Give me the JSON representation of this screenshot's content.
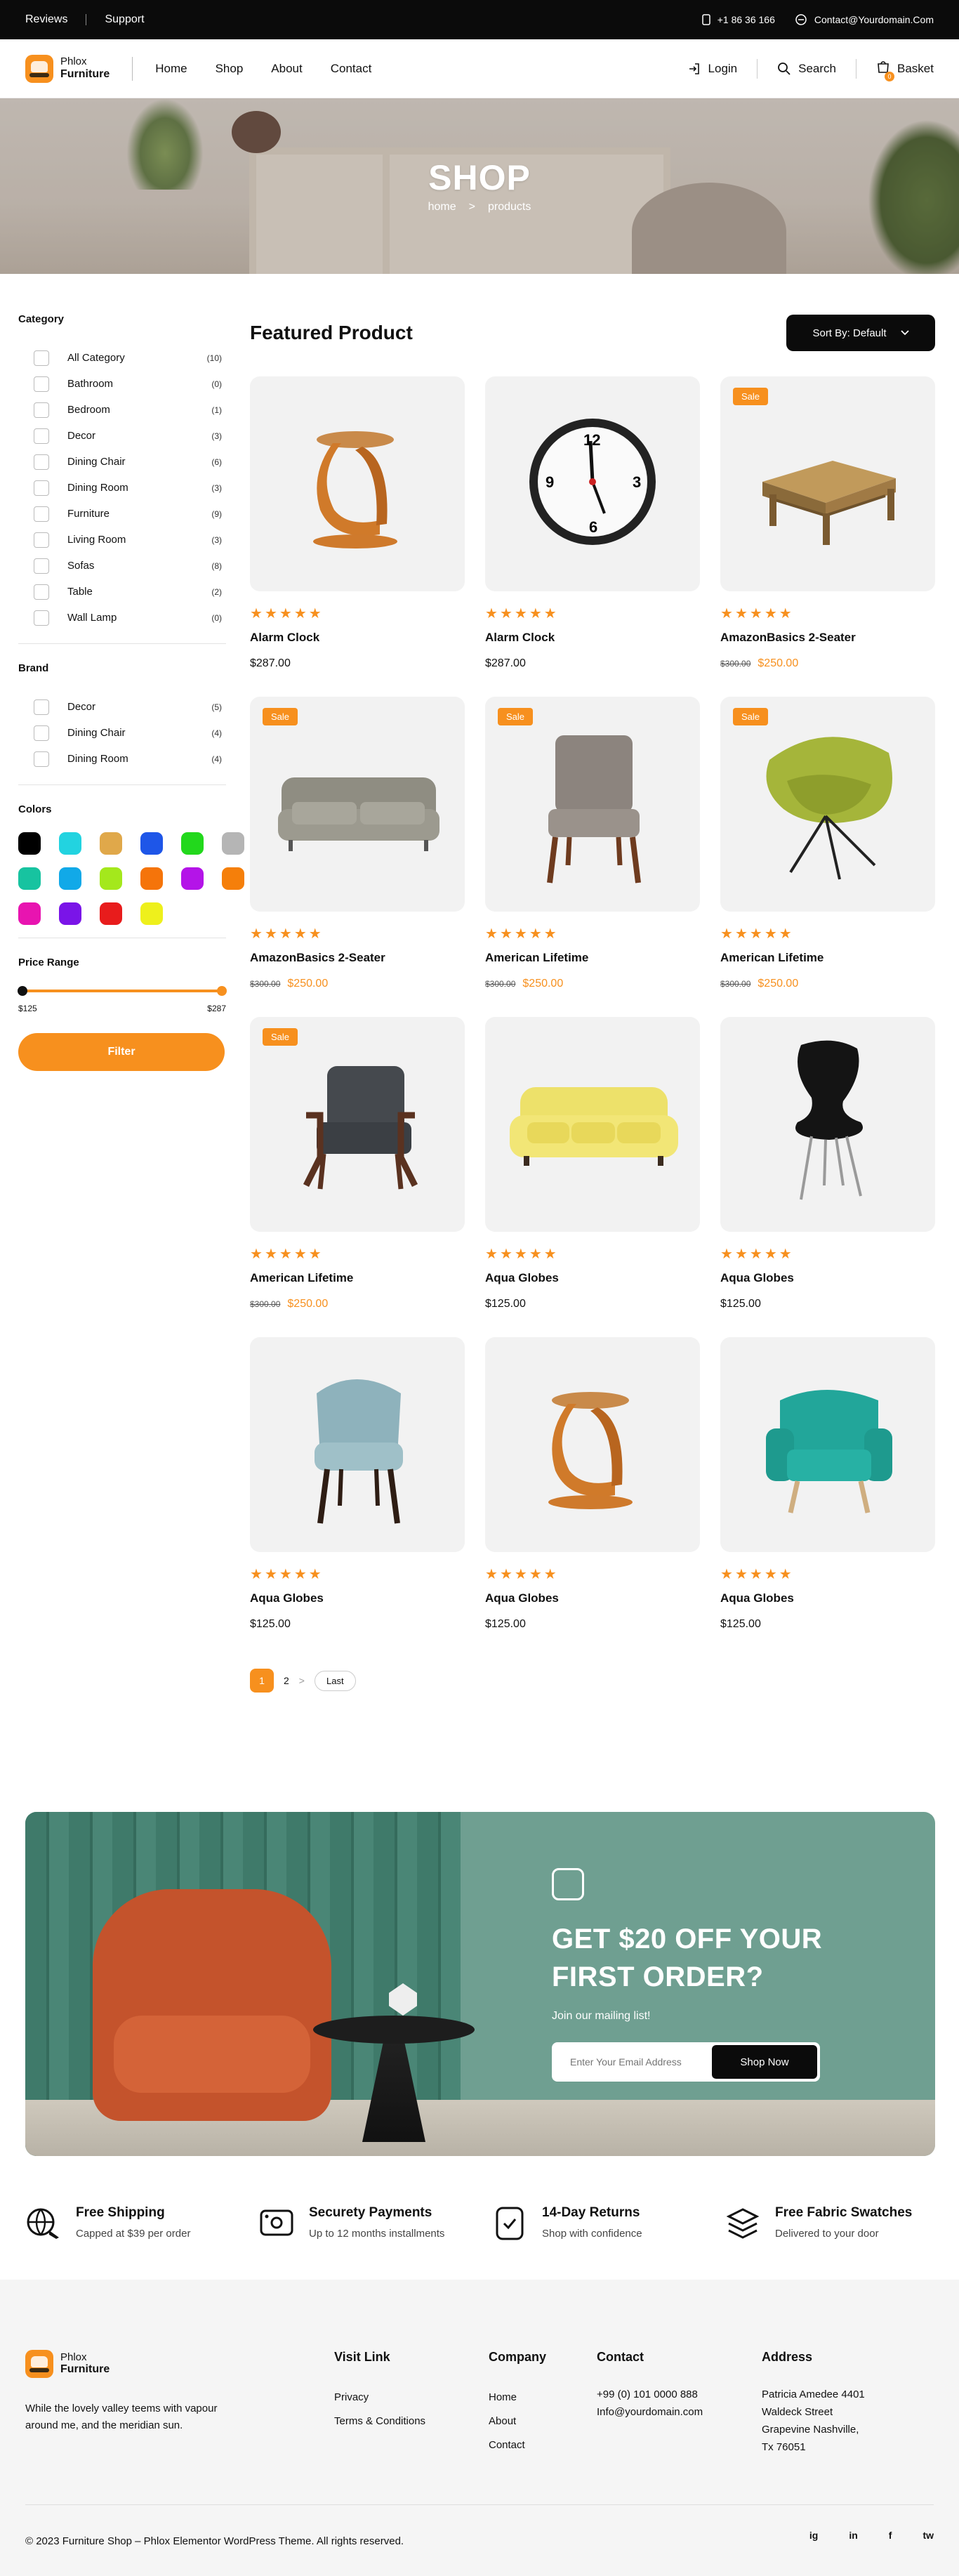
{
  "topbar": {
    "reviews": "Reviews",
    "support": "Support",
    "phone": "+1 86 36 166",
    "email": "Contact@Yourdomain.Com"
  },
  "header": {
    "logo_line1": "Phlox",
    "logo_line2": "Furniture",
    "nav": [
      "Home",
      "Shop",
      "About",
      "Contact"
    ],
    "login": "Login",
    "search": "Search",
    "basket": "Basket",
    "basket_count": "0"
  },
  "hero": {
    "title": "SHOP",
    "crumb_home": "home",
    "crumb_sep": ">",
    "crumb_current": "products"
  },
  "sidebar": {
    "category_title": "Category",
    "categories": [
      {
        "label": "All Category",
        "count": "(10)"
      },
      {
        "label": "Bathroom",
        "count": "(0)"
      },
      {
        "label": "Bedroom",
        "count": "(1)"
      },
      {
        "label": "Decor",
        "count": "(3)"
      },
      {
        "label": "Dining Chair",
        "count": "(6)"
      },
      {
        "label": "Dining Room",
        "count": "(3)"
      },
      {
        "label": "Furniture",
        "count": "(9)"
      },
      {
        "label": "Living Room",
        "count": "(3)"
      },
      {
        "label": "Sofas",
        "count": "(8)"
      },
      {
        "label": "Table",
        "count": "(2)"
      },
      {
        "label": "Wall Lamp",
        "count": "(0)"
      }
    ],
    "brand_title": "Brand",
    "brands": [
      {
        "label": "Decor",
        "count": "(5)"
      },
      {
        "label": "Dining Chair",
        "count": "(4)"
      },
      {
        "label": "Dining Room",
        "count": "(4)"
      }
    ],
    "colors_title": "Colors",
    "colors": [
      "#000000",
      "#22d3e0",
      "#e0a84a",
      "#1e56e8",
      "#22d81c",
      "#b5b5b5",
      "#17c3a0",
      "#11a9e8",
      "#a4e81c",
      "#f5740a",
      "#b414e8",
      "#f57f0a",
      "#e814b0",
      "#7a14e8",
      "#e81c1c",
      "#eef01c"
    ],
    "price_title": "Price Range",
    "price_min": "$125",
    "price_max": "$287",
    "filter_label": "Filter"
  },
  "main": {
    "title": "Featured Product",
    "sort_label": "Sort By: Default"
  },
  "products": [
    {
      "name": "Alarm Clock",
      "price": "$287.00",
      "old": "",
      "sale": "",
      "img": "chair-c-icon"
    },
    {
      "name": "Alarm Clock",
      "price": "$287.00",
      "old": "",
      "sale": "",
      "img": "clock-icon"
    },
    {
      "name": "AmazonBasics 2-Seater",
      "price": "$250.00",
      "old": "$300.00",
      "sale": "Sale",
      "img": "table-icon"
    },
    {
      "name": "AmazonBasics 2-Seater",
      "price": "$250.00",
      "old": "$300.00",
      "sale": "Sale",
      "img": "sofa-gray-icon"
    },
    {
      "name": "American Lifetime",
      "price": "$250.00",
      "old": "$300.00",
      "sale": "Sale",
      "img": "chair-gray-icon"
    },
    {
      "name": "American Lifetime",
      "price": "$250.00",
      "old": "$300.00",
      "sale": "Sale",
      "img": "chair-green-icon"
    },
    {
      "name": "American Lifetime",
      "price": "$250.00",
      "old": "$300.00",
      "sale": "Sale",
      "img": "armchair-dark-icon"
    },
    {
      "name": "Aqua Globes",
      "price": "$125.00",
      "old": "",
      "sale": "",
      "img": "sofa-yellow-icon"
    },
    {
      "name": "Aqua Globes",
      "price": "$125.00",
      "old": "",
      "sale": "",
      "img": "chair-black-icon"
    },
    {
      "name": "Aqua Globes",
      "price": "$125.00",
      "old": "",
      "sale": "",
      "img": "chair-blue-icon"
    },
    {
      "name": "Aqua Globes",
      "price": "$125.00",
      "old": "",
      "sale": "",
      "img": "chair-c-icon"
    },
    {
      "name": "Aqua Globes",
      "price": "$125.00",
      "old": "",
      "sale": "",
      "img": "armchair-teal-icon"
    }
  ],
  "pagination": {
    "current": "1",
    "next": "2",
    "arrow": ">",
    "last": "Last"
  },
  "promo": {
    "title": "GET $20 OFF YOUR FIRST ORDER?",
    "subtitle": "Join our mailing list!",
    "email_placeholder": "Enter Your Email Address",
    "button": "Shop Now"
  },
  "features": [
    {
      "title": "Free Shipping",
      "text": "Capped at $39 per order",
      "icon": "globe-plane-icon"
    },
    {
      "title": "Securety Payments",
      "text": "Up to 12 months installments",
      "icon": "card-icon"
    },
    {
      "title": "14-Day Returns",
      "text": "Shop with confidence",
      "icon": "return-icon"
    },
    {
      "title": "Free Fabric Swatches",
      "text": "Delivered to your door",
      "icon": "layers-icon"
    }
  ],
  "footer": {
    "about": "While the lovely valley teems with vapour around me, and the meridian sun.",
    "visit_title": "Visit Link",
    "visit": [
      "Privacy",
      "Terms & Conditions"
    ],
    "company_title": "Company",
    "company": [
      "Home",
      "About",
      "Contact"
    ],
    "contact_title": "Contact",
    "contact": [
      "+99 (0) 101 0000 888",
      "Info@yourdomain.com"
    ],
    "address_title": "Address",
    "address": [
      "Patricia Amedee 4401",
      "Waldeck Street",
      "Grapevine Nashville,",
      "Tx 76051"
    ],
    "copyright": "© 2023 Furniture Shop – Phlox Elementor WordPress Theme. All rights reserved.",
    "social": [
      "ig",
      "in",
      "f",
      "tw"
    ]
  },
  "colors": {
    "accent": "#f7901e",
    "dark": "#0b0b0b",
    "promo_bg": "#6f9f91"
  }
}
